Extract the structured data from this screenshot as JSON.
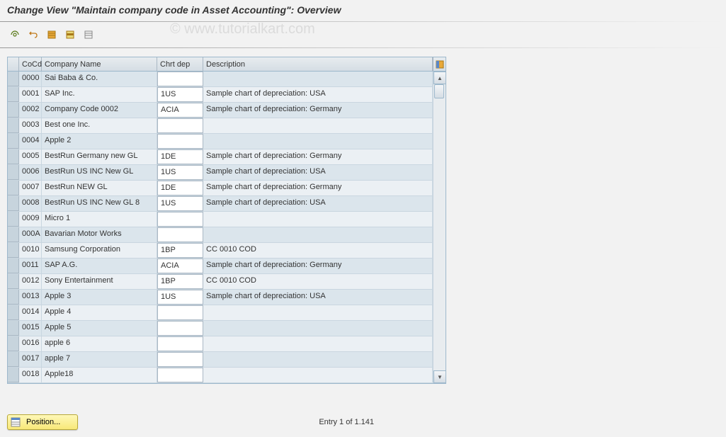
{
  "title": "Change View \"Maintain company code in Asset Accounting\": Overview",
  "watermark": "© www.tutorialkart.com",
  "columns": {
    "sel": "",
    "cocd": "CoCd",
    "name": "Company Name",
    "chrt": "Chrt dep",
    "desc": "Description"
  },
  "rows": [
    {
      "cocd": "0000",
      "name": "Sai Baba & Co.",
      "chrt": "",
      "desc": ""
    },
    {
      "cocd": "0001",
      "name": "SAP Inc.",
      "chrt": "1US",
      "desc": "Sample chart of depreciation: USA"
    },
    {
      "cocd": "0002",
      "name": "Company Code 0002",
      "chrt": "ACIA",
      "desc": "Sample chart of depreciation: Germany"
    },
    {
      "cocd": "0003",
      "name": "Best one Inc.",
      "chrt": "",
      "desc": ""
    },
    {
      "cocd": "0004",
      "name": "Apple 2",
      "chrt": "",
      "desc": ""
    },
    {
      "cocd": "0005",
      "name": "BestRun Germany new GL",
      "chrt": "1DE",
      "desc": "Sample chart of depreciation: Germany"
    },
    {
      "cocd": "0006",
      "name": "BestRun US INC New GL",
      "chrt": "1US",
      "desc": "Sample chart of depreciation: USA"
    },
    {
      "cocd": "0007",
      "name": "BestRun NEW GL",
      "chrt": "1DE",
      "desc": "Sample chart of depreciation: Germany"
    },
    {
      "cocd": "0008",
      "name": "BestRun US INC New GL 8",
      "chrt": "1US",
      "desc": "Sample chart of depreciation: USA"
    },
    {
      "cocd": "0009",
      "name": "Micro 1",
      "chrt": "",
      "desc": ""
    },
    {
      "cocd": "000A",
      "name": "Bavarian Motor Works",
      "chrt": "",
      "desc": ""
    },
    {
      "cocd": "0010",
      "name": "Samsung Corporation",
      "chrt": "1BP",
      "desc": "CC 0010 COD"
    },
    {
      "cocd": "0011",
      "name": "SAP A.G.",
      "chrt": "ACIA",
      "desc": "Sample chart of depreciation: Germany"
    },
    {
      "cocd": "0012",
      "name": "Sony Entertainment",
      "chrt": "1BP",
      "desc": "CC 0010 COD"
    },
    {
      "cocd": "0013",
      "name": "Apple 3",
      "chrt": "1US",
      "desc": "Sample chart of depreciation: USA"
    },
    {
      "cocd": "0014",
      "name": "Apple 4",
      "chrt": "",
      "desc": ""
    },
    {
      "cocd": "0015",
      "name": "Apple 5",
      "chrt": "",
      "desc": ""
    },
    {
      "cocd": "0016",
      "name": "apple 6",
      "chrt": "",
      "desc": ""
    },
    {
      "cocd": "0017",
      "name": "apple 7",
      "chrt": "",
      "desc": ""
    },
    {
      "cocd": "0018",
      "name": "Apple18",
      "chrt": "",
      "desc": ""
    }
  ],
  "footer": {
    "position_label": "Position...",
    "entry_text": "Entry 1 of 1.141"
  }
}
